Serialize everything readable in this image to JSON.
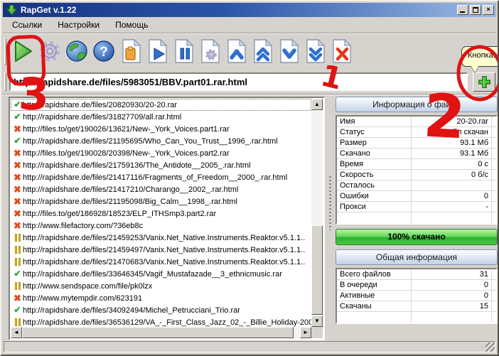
{
  "window": {
    "title": "RapGet v.1.22",
    "controls": {
      "minimize": "minimize",
      "maximize": "maximize",
      "close": "×"
    }
  },
  "menu": {
    "items": [
      {
        "label": "Ссылки"
      },
      {
        "label": "Настройки"
      },
      {
        "label": "Помощь"
      }
    ]
  },
  "toolbar": {
    "icons": [
      "start-downloads-icon",
      "settings-gear-icon",
      "globe-icon",
      "help-icon",
      "paste-links-file-icon",
      "start-file-icon",
      "pause-file-icon",
      "file-properties-icon",
      "move-up-icon",
      "move-top-icon",
      "move-down-icon",
      "move-bottom-icon",
      "delete-file-icon"
    ]
  },
  "url_bar": {
    "value": "http://rapidshare.de/files/5983051/BBV.part01.rar.html",
    "add_button_icon": "add-link-plus-icon",
    "tooltip": "Кнопка..."
  },
  "download_list": {
    "rows": [
      {
        "status": "done",
        "selected": true,
        "url": "http://rapidshare.de/files/20820930/20-20.rar"
      },
      {
        "status": "done",
        "selected": false,
        "url": "http://rapidshare.de/files/31827709/all.rar.html"
      },
      {
        "status": "error",
        "selected": false,
        "url": "http://files.to/get/190026/13621/New-_York_Voices.part1.rar"
      },
      {
        "status": "done",
        "selected": false,
        "url": "http://rapidshare.de/files/21195695/Who_Can_You_Trust__1996_.rar.html"
      },
      {
        "status": "error",
        "selected": false,
        "url": "http://files.to/get/190028/20398/New-_York_Voices.part2.rar"
      },
      {
        "status": "error",
        "selected": false,
        "url": "http://rapidshare.de/files/21759136/The_Antidote__2005_.rar.html"
      },
      {
        "status": "error",
        "selected": false,
        "url": "http://rapidshare.de/files/21417116/Fragments_of_Freedom__2000_.rar.html"
      },
      {
        "status": "error",
        "selected": false,
        "url": "http://rapidshare.de/files/21417210/Charango__2002_.rar.html"
      },
      {
        "status": "error",
        "selected": false,
        "url": "http://rapidshare.de/files/21195098/Big_Calm__1998_.rar.html"
      },
      {
        "status": "error",
        "selected": false,
        "url": "http://files.to/get/186928/18523/ELP_ITHSmp3.part2.rar"
      },
      {
        "status": "error",
        "selected": false,
        "url": "http://www.filefactory.com/?36eb8c"
      },
      {
        "status": "paused",
        "selected": false,
        "url": "http://rapidshare.de/files/21459253/Vanix.Net_Native.Instruments.Reaktor.v5.1.1.."
      },
      {
        "status": "paused",
        "selected": false,
        "url": "http://rapidshare.de/files/21459497/Vanix.Net_Native.Instruments.Reaktor.v5.1.1.."
      },
      {
        "status": "paused",
        "selected": false,
        "url": "http://rapidshare.de/files/21470683/Vanix.Net_Native.Instruments.Reaktor.v5.1.1.."
      },
      {
        "status": "done",
        "selected": false,
        "url": "http://rapidshare.de/files/33646345/Vagif_Mustafazade__3_ethnicmusic.rar"
      },
      {
        "status": "paused",
        "selected": false,
        "url": "http://www.sendspace.com/file/pk0lzx"
      },
      {
        "status": "error",
        "selected": false,
        "url": "http://www.mytempdir.com/623191"
      },
      {
        "status": "done",
        "selected": false,
        "url": "http://rapidshare.de/files/34092494/Michel_Petrucciani_Trio.rar"
      },
      {
        "status": "paused",
        "selected": false,
        "url": "http://rapidshare.de/files/36536129/VA_-_First_Class_Jazz_02_-_Billie_Holiday-200"
      }
    ],
    "status_glyphs": {
      "done": "✔",
      "error": "✖",
      "paused": "pause-bars"
    }
  },
  "file_info": {
    "header": "Информация о файле",
    "rows": [
      {
        "label": "Имя",
        "value": "20-20.rar"
      },
      {
        "label": "Статус",
        "value": "Файл скачан"
      },
      {
        "label": "Размер",
        "value": "93.1 Мб"
      },
      {
        "label": "Скачано",
        "value": "93.1 Мб"
      },
      {
        "label": "Время",
        "value": "0 с"
      },
      {
        "label": "Скорость",
        "value": "0 б/с"
      },
      {
        "label": "Осталось",
        "value": ""
      },
      {
        "label": "Ошибки",
        "value": "0"
      },
      {
        "label": "Прокси",
        "value": "-"
      },
      {
        "label": "",
        "value": ""
      }
    ]
  },
  "progress": {
    "percent": 100,
    "label": "100% скачано"
  },
  "general_info": {
    "header": "Общая информация",
    "rows": [
      {
        "label": "Всего файлов",
        "value": "31"
      },
      {
        "label": "В очереди",
        "value": "0"
      },
      {
        "label": "Активные",
        "value": "0"
      },
      {
        "label": "Скачаны",
        "value": "15"
      },
      {
        "label": "",
        "value": ""
      }
    ]
  },
  "annotations": {
    "color": "#e01212",
    "items": [
      {
        "label": "1"
      },
      {
        "label": "2"
      },
      {
        "label": "3"
      }
    ]
  },
  "colors": {
    "titlebar_left": "#17337f",
    "titlebar_right": "#9cbbe4",
    "chrome": "#d6d3ce",
    "progress_green": "#2eb22e",
    "status_done": "#2fa434",
    "status_error": "#dd5020",
    "status_paused": "#e8c51b",
    "annotation_red": "#e01212",
    "tooltip_yellow": "#ffffd2"
  }
}
